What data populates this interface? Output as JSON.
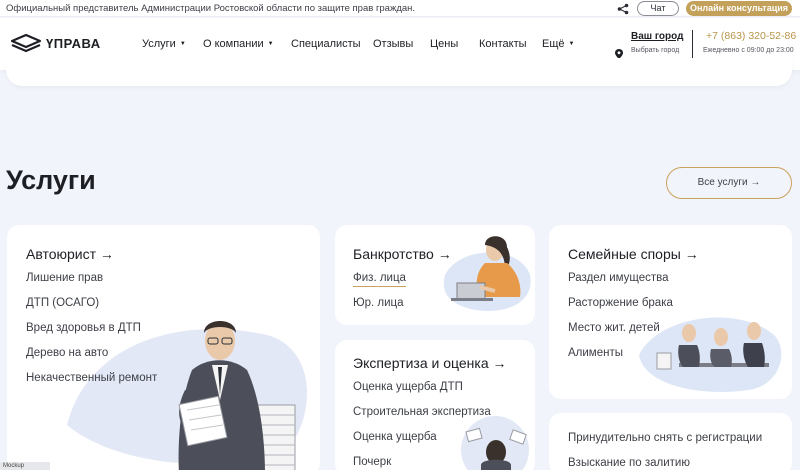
{
  "topbar": {
    "notice": "Официальный представитель Администрации Ростовской области по защите прав граждан.",
    "share_icon": "share-icon",
    "chat_label": "Чат",
    "consult_label": "Онлайн консультация"
  },
  "header": {
    "logo_text": "ҮПРАВА",
    "nav": [
      {
        "label": "Услуги",
        "has_caret": true
      },
      {
        "label": "О компании",
        "has_caret": true
      },
      {
        "label": "Специалисты",
        "has_caret": false
      },
      {
        "label": "Отзывы",
        "has_caret": false
      },
      {
        "label": "Цены",
        "has_caret": false
      },
      {
        "label": "Контакты",
        "has_caret": false
      },
      {
        "label": "Ещё",
        "has_caret": true
      }
    ],
    "caret": "▼",
    "city_title": "Ваш город",
    "city_sub": "Выбрать город",
    "phone": "+7 (863) 320-52-86",
    "hours": "Ежедневно с 09:00 до 23:00"
  },
  "services": {
    "title": "Услуги",
    "all_label": "Все услуги →",
    "cards": {
      "avto": {
        "title": "Автоюрист →",
        "items": [
          "Лишение прав",
          "ДТП (ОСАГО)",
          "Вред здоровья в ДТП",
          "Дерево на авто",
          "Некачественный ремонт"
        ]
      },
      "bank": {
        "title": "Банкротство →",
        "items": [
          "Физ. лица",
          "Юр. лица"
        ]
      },
      "exp": {
        "title": "Экспертиза и оценка →",
        "items": [
          "Оценка ущерба ДТП",
          "Строительная экспертиза",
          "Оценка ущерба",
          "Почерк"
        ]
      },
      "family": {
        "title": "Семейные споры →",
        "items": [
          "Раздел имущества",
          "Расторжение брака",
          "Место жит. детей",
          "Алименты"
        ]
      },
      "other": {
        "items": [
          "Принудительно снять с регистрации",
          "Взыскание по залитию"
        ]
      }
    }
  },
  "colors": {
    "accent_gold": "#c3a15a",
    "page_bg": "#f1f4fb",
    "card_bg": "#ffffff"
  },
  "corner_tag": "Mockup"
}
